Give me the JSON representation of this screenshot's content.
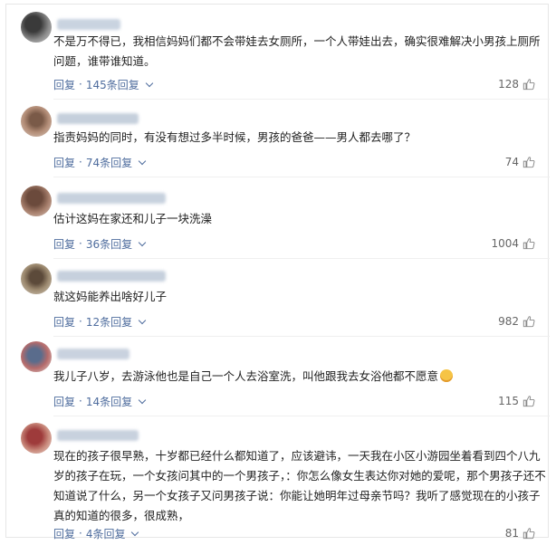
{
  "comments": [
    {
      "text": "不是万不得已，我相信妈妈们都不会带娃去女厕所，一个人带娃出去，确实很难解决小男孩上厕所问题，谁带谁知道。",
      "reply_label": "回复",
      "replies_label": "145条回复",
      "likes": "128"
    },
    {
      "text": "指责妈妈的同时，有没有想过多半时候，男孩的爸爸——男人都去哪了？",
      "reply_label": "回复",
      "replies_label": "74条回复",
      "likes": "74"
    },
    {
      "text": "估计这妈在家还和儿子一块洗澡",
      "reply_label": "回复",
      "replies_label": "36条回复",
      "likes": "1004"
    },
    {
      "text": "就这妈能养出啥好儿子",
      "reply_label": "回复",
      "replies_label": "12条回复",
      "likes": "982"
    },
    {
      "text": "我儿子八岁，去游泳他也是自己一个人去浴室洗，叫他跟我去女浴他都不愿意",
      "reply_label": "回复",
      "replies_label": "14条回复",
      "likes": "115"
    },
    {
      "text": "现在的孩子很早熟，十岁都已经什么都知道了，应该避讳，一天我在小区小游园坐着看到四个八九岁的孩子在玩，一个女孩问其中的一个男孩子，：你怎么像女生表达你对她的爱呢，那个男孩子还不知道说了什么，另一个女孩子又问男孩子说：你能让她明年过母亲节吗？我听了感觉现在的小孩子真的知道的很多，很成熟，",
      "reply_label": "回复",
      "replies_label": "4条回复",
      "likes": "81"
    }
  ],
  "separator": "·",
  "colors": {
    "link": "#4f6d9e",
    "text": "#222222",
    "muted": "#666666"
  }
}
